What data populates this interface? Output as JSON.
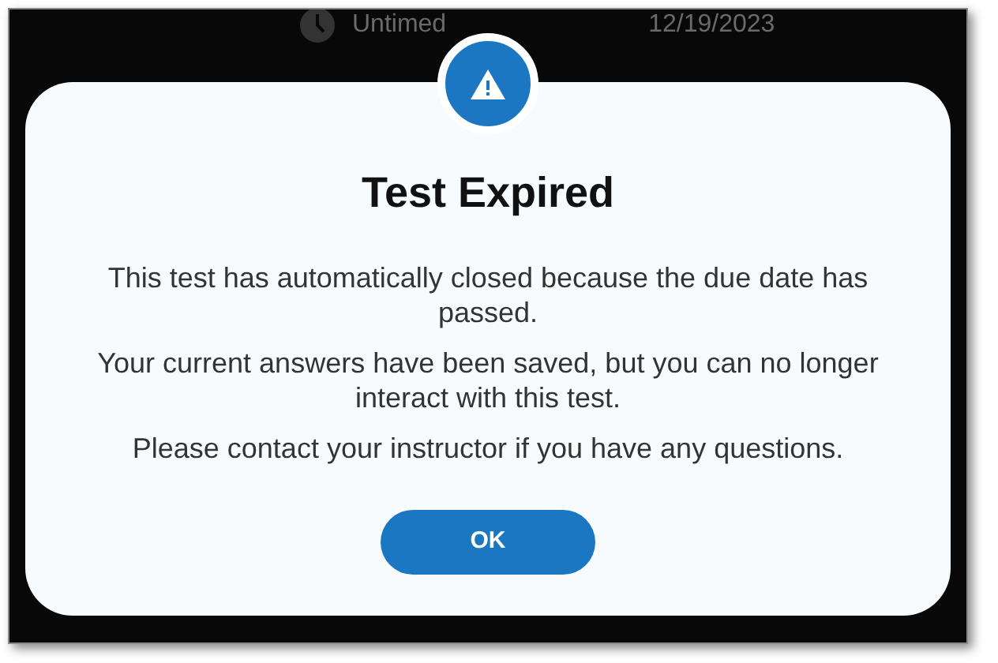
{
  "background_row": {
    "timing": "Untimed",
    "date": "12/19/2023"
  },
  "dialog": {
    "title": "Test Expired",
    "paragraphs": [
      "This test has automatically closed because the due date has passed.",
      "Your current answers have been saved, but you can no longer interact with this test.",
      "Please contact your instructor if you have any questions."
    ],
    "buttons": [
      "OK"
    ]
  }
}
